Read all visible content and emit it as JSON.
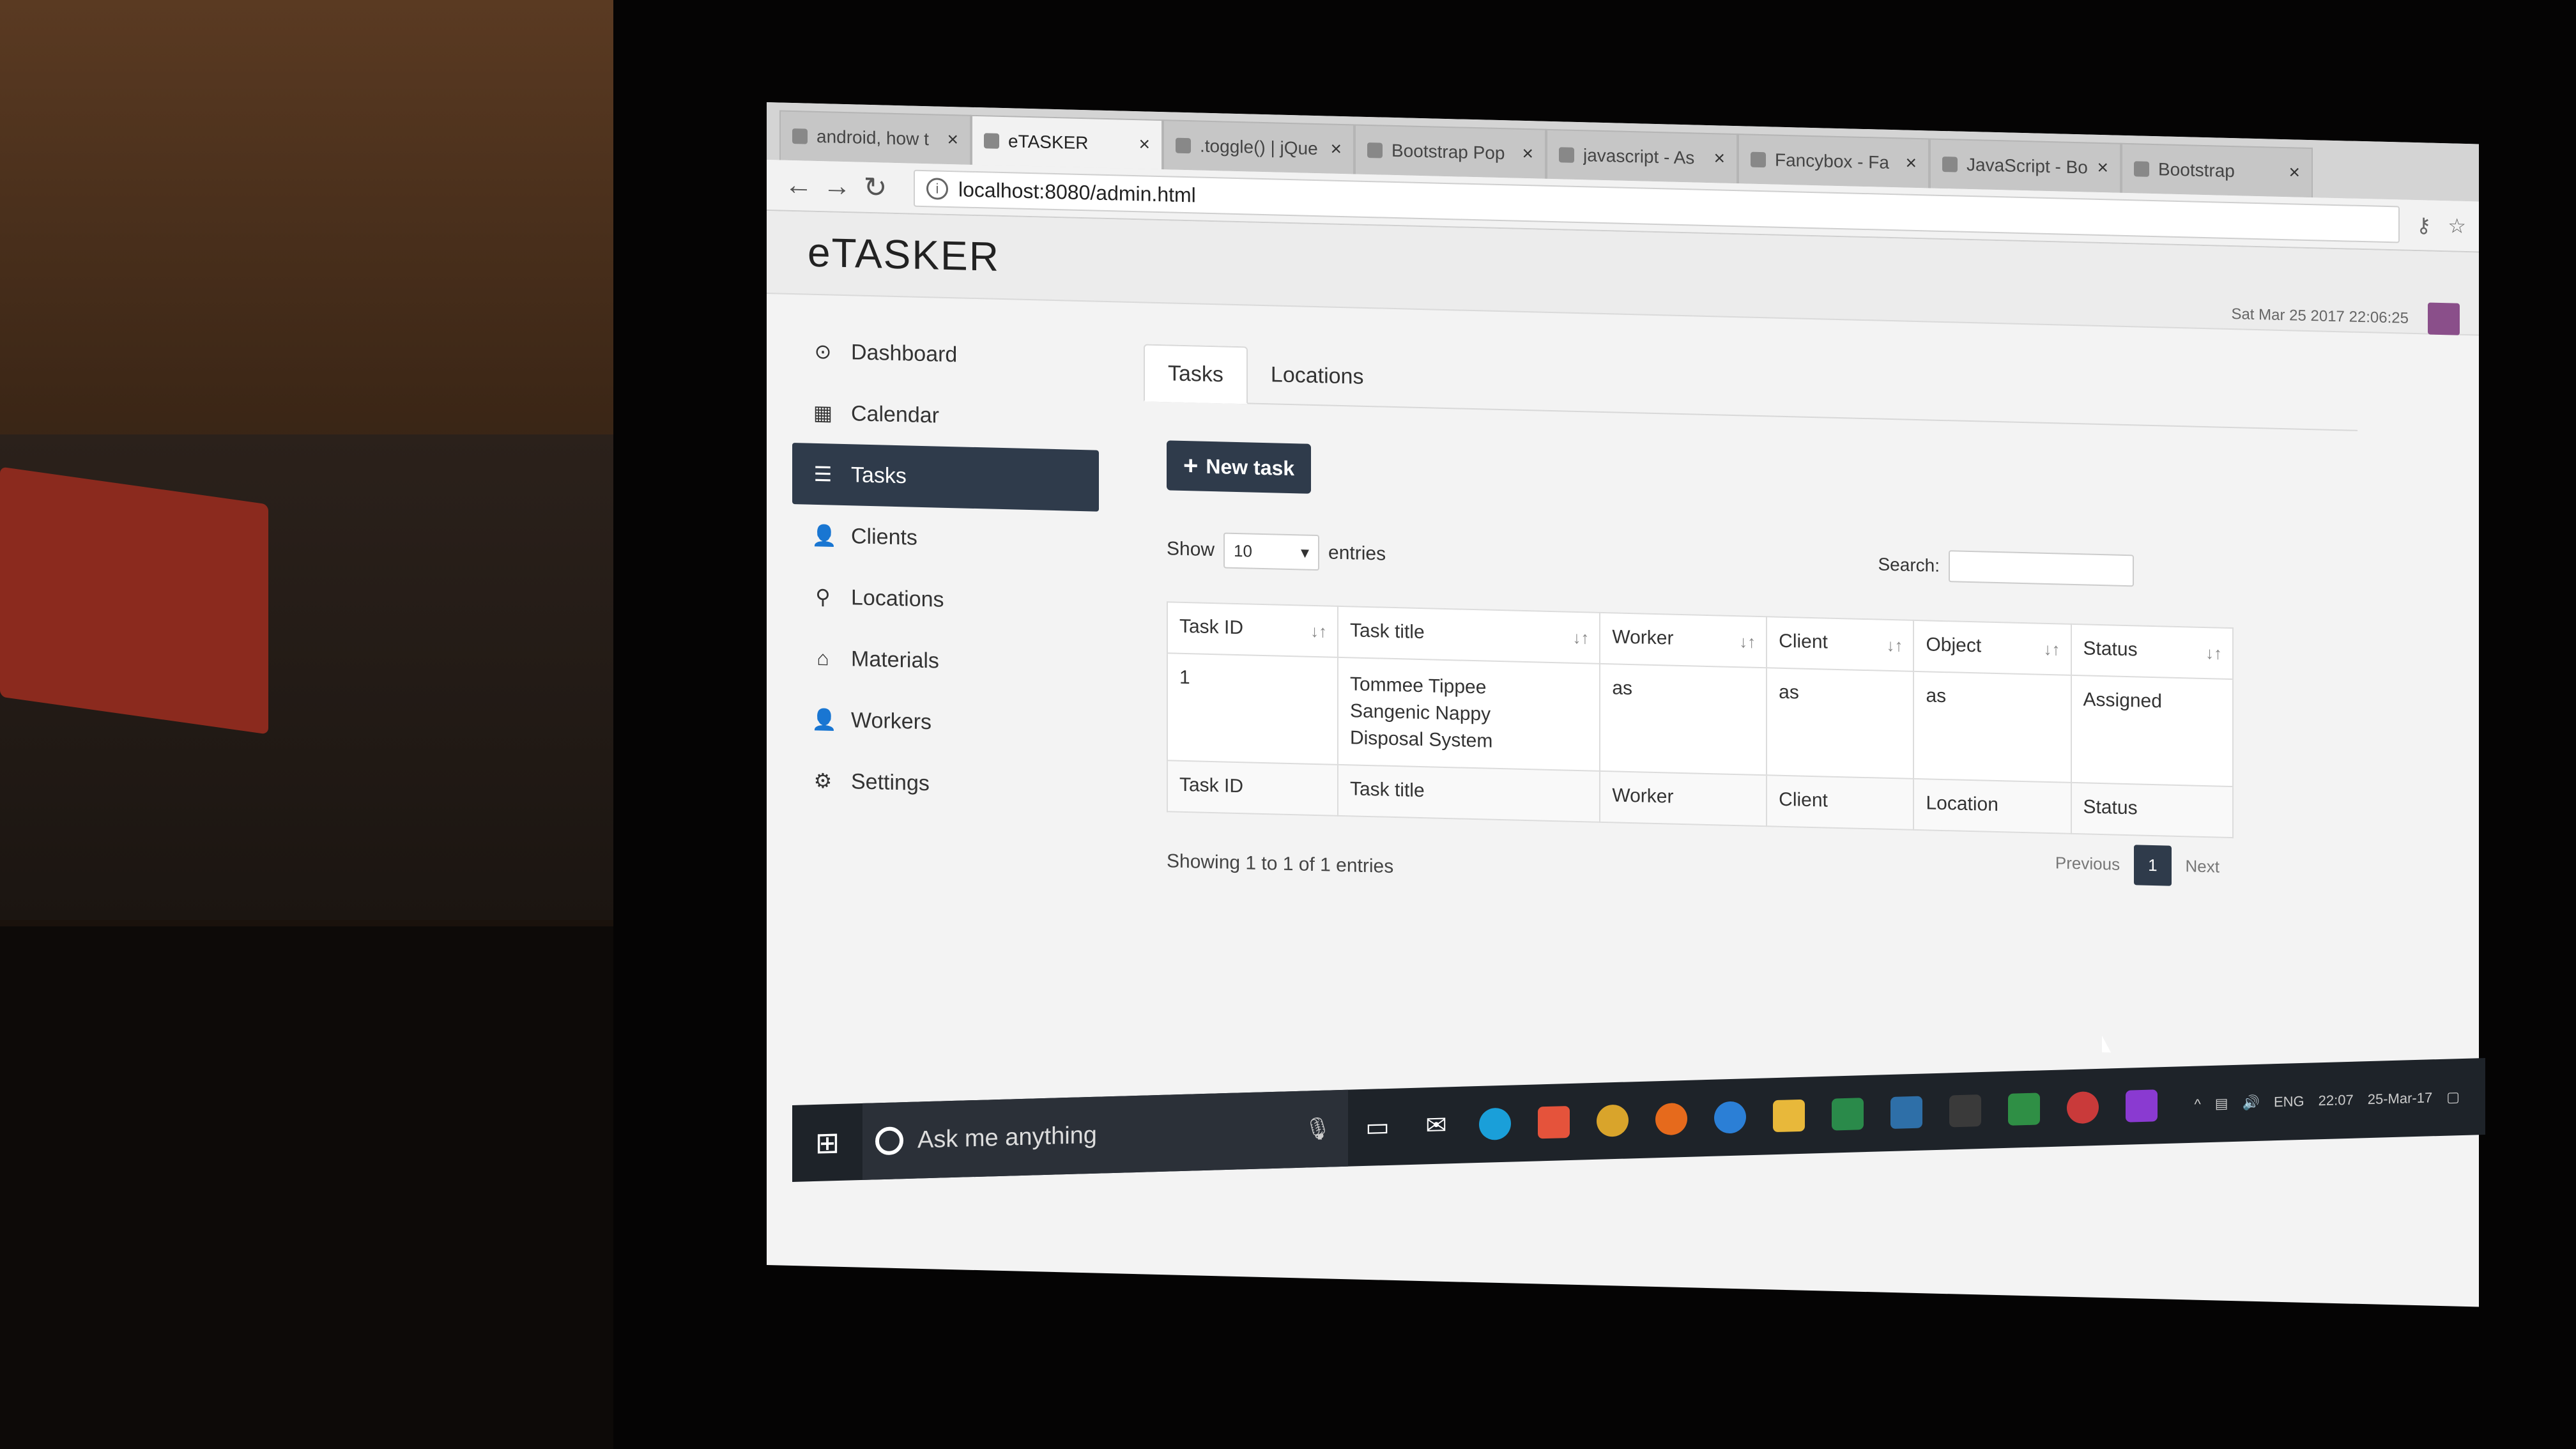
{
  "browser": {
    "tabs": [
      {
        "label": "android, how t",
        "active": false
      },
      {
        "label": "eTASKER",
        "active": true
      },
      {
        "label": ".toggle() | jQue",
        "active": false
      },
      {
        "label": "Bootstrap Pop",
        "active": false
      },
      {
        "label": "javascript - As",
        "active": false
      },
      {
        "label": "Fancybox - Fa",
        "active": false
      },
      {
        "label": "JavaScript - Bo",
        "active": false
      },
      {
        "label": "Bootstrap",
        "active": false
      }
    ],
    "url": "localhost:8080/admin.html",
    "icons": [
      "back-icon",
      "forward-icon",
      "reload-icon",
      "info-icon",
      "key-icon",
      "star-icon"
    ]
  },
  "app": {
    "brand": "eTASKER",
    "datetime": "Sat Mar 25 2017 22:06:25"
  },
  "sidebar": {
    "items": [
      {
        "label": "Dashboard",
        "icon": "dashboard-icon",
        "glyph": "⊙",
        "active": false
      },
      {
        "label": "Calendar",
        "icon": "calendar-icon",
        "glyph": "▦",
        "active": false
      },
      {
        "label": "Tasks",
        "icon": "tasks-icon",
        "glyph": "☰",
        "active": true
      },
      {
        "label": "Clients",
        "icon": "user-icon",
        "glyph": "👤",
        "active": false
      },
      {
        "label": "Locations",
        "icon": "map-marker-icon",
        "glyph": "⚲",
        "active": false
      },
      {
        "label": "Materials",
        "icon": "inbox-icon",
        "glyph": "⌂",
        "active": false
      },
      {
        "label": "Workers",
        "icon": "user-icon",
        "glyph": "👤",
        "active": false
      },
      {
        "label": "Settings",
        "icon": "gear-icon",
        "glyph": "⚙",
        "active": false
      }
    ]
  },
  "main": {
    "tabs": [
      {
        "label": "Tasks",
        "active": true
      },
      {
        "label": "Locations",
        "active": false
      }
    ],
    "new_task_label": "New task",
    "show_label": "Show",
    "entries_value": "10",
    "entries_label": "entries",
    "search_label": "Search:",
    "search_value": "",
    "table": {
      "headers": [
        "Task ID",
        "Task title",
        "Worker",
        "Client",
        "Object",
        "Status"
      ],
      "rows": [
        {
          "task_id": "1",
          "title_lines": [
            "Tommee Tippee",
            "Sangenic Nappy",
            "Disposal System"
          ],
          "worker": "as",
          "client": "as",
          "object": "as",
          "status": "Assigned"
        }
      ],
      "footer": [
        "Task ID",
        "Task title",
        "Worker",
        "Client",
        "Location",
        "Status"
      ]
    },
    "info": "Showing 1 to 1 of 1 entries",
    "pager": {
      "previous": "Previous",
      "current": "1",
      "next": "Next"
    }
  },
  "taskbar": {
    "search_placeholder": "Ask me anything",
    "tray_lang": "ENG",
    "tray_time": "22:07",
    "tray_date": "25-Mar-17"
  }
}
